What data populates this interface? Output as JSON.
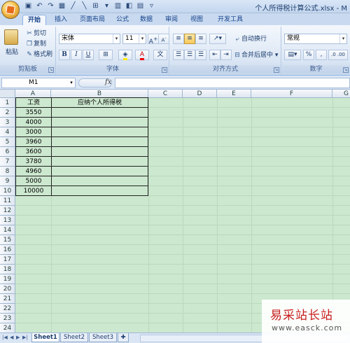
{
  "window": {
    "title": "个人所得税计算公式.xlsx - M"
  },
  "tabs": [
    "开始",
    "插入",
    "页面布局",
    "公式",
    "数据",
    "审阅",
    "视图",
    "开发工具"
  ],
  "ribbon": {
    "clipboard": {
      "paste": "粘贴",
      "cut": "剪切",
      "copy": "复制",
      "format_painter": "格式刷",
      "label": "剪贴板"
    },
    "font": {
      "name": "宋体",
      "size": "11",
      "label": "字体",
      "bold": "B",
      "italic": "I",
      "underline": "U"
    },
    "alignment": {
      "wrap": "自动换行",
      "merge": "合并后居中",
      "label": "对齐方式"
    },
    "number": {
      "format": "常规",
      "label": "数字"
    }
  },
  "formula_bar": {
    "name_box": "M1",
    "fx": "fx",
    "content": ""
  },
  "columns": [
    "A",
    "B",
    "C",
    "D",
    "E",
    "F",
    "G"
  ],
  "rows": [
    "1",
    "2",
    "3",
    "4",
    "5",
    "6",
    "7",
    "8",
    "9",
    "10",
    "11",
    "12",
    "13",
    "14",
    "15",
    "16",
    "17",
    "18",
    "19",
    "20",
    "21",
    "22",
    "23",
    "24"
  ],
  "table": {
    "headers": [
      "工资",
      "应纳个人所得税"
    ],
    "salaries": [
      "3550",
      "4000",
      "3000",
      "3960",
      "3600",
      "3780",
      "4960",
      "5000",
      "10000"
    ]
  },
  "sheets": [
    "Sheet1",
    "Sheet2",
    "Sheet3"
  ],
  "watermark": {
    "title": "易采站长站",
    "url": "www.easck.com"
  },
  "colors": {
    "grid_background": "#cce8cf",
    "watermark_red": "#c81e1e"
  }
}
